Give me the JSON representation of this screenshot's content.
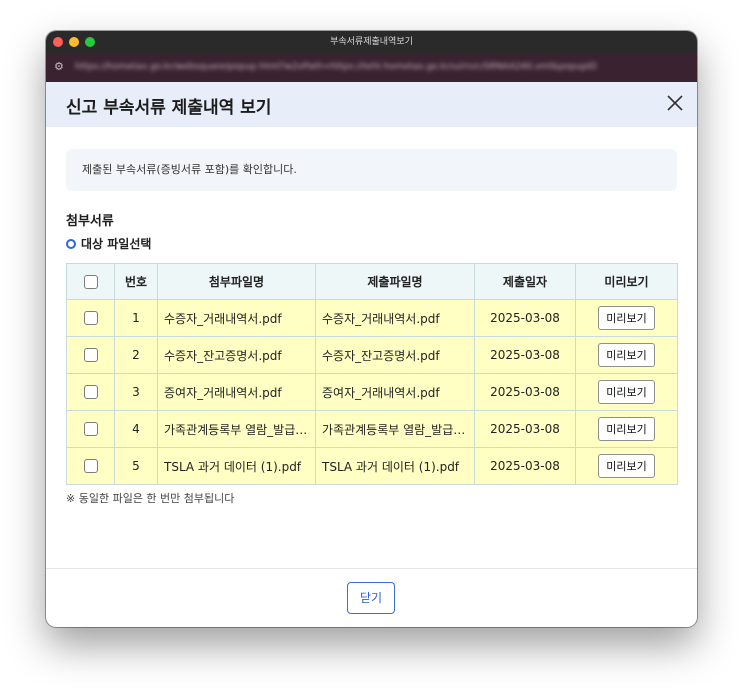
{
  "window": {
    "title": "부속서류제출내역보기",
    "url": "https://hometax.go.kr/websquare/popup.html?w2xPath=https://teht.hometax.go.kr/ui/rn/c/SRNAA240.xml&popupID"
  },
  "dialog": {
    "title": "신고 부속서류 제출내역 보기",
    "notice": "제출된 부속서류(증빙서류 포함)를 확인합니다.",
    "section_title": "첨부서류",
    "radio_label": "대상 파일선택",
    "footnote": "※ 동일한 파일은 한 번만 첨부됩니다",
    "close_button": "닫기"
  },
  "table": {
    "headers": [
      "번호",
      "첨부파일명",
      "제출파일명",
      "제출일자",
      "미리보기"
    ],
    "rows": [
      {
        "no": "1",
        "attached": "수증자_거래내역서.pdf",
        "submitted": "수증자_거래내역서.pdf",
        "date": "2025-03-08",
        "preview": "미리보기"
      },
      {
        "no": "2",
        "attached": "수증자_잔고증명서.pdf",
        "submitted": "수증자_잔고증명서.pdf",
        "date": "2025-03-08",
        "preview": "미리보기"
      },
      {
        "no": "3",
        "attached": "증여자_거래내역서.pdf",
        "submitted": "증여자_거래내역서.pdf",
        "date": "2025-03-08",
        "preview": "미리보기"
      },
      {
        "no": "4",
        "attached": "가족관계등록부 열람_발급…",
        "submitted": "가족관계등록부 열람_발급…",
        "date": "2025-03-08",
        "preview": "미리보기"
      },
      {
        "no": "5",
        "attached": "TSLA 과거 데이터 (1).pdf",
        "submitted": "TSLA 과거 데이터 (1).pdf",
        "date": "2025-03-08",
        "preview": "미리보기"
      }
    ]
  },
  "colors": {
    "header_bg": "#e8eef9",
    "row_highlight": "#ffffc4",
    "table_header_bg": "#eef7f7",
    "accent": "#2f67d8"
  }
}
